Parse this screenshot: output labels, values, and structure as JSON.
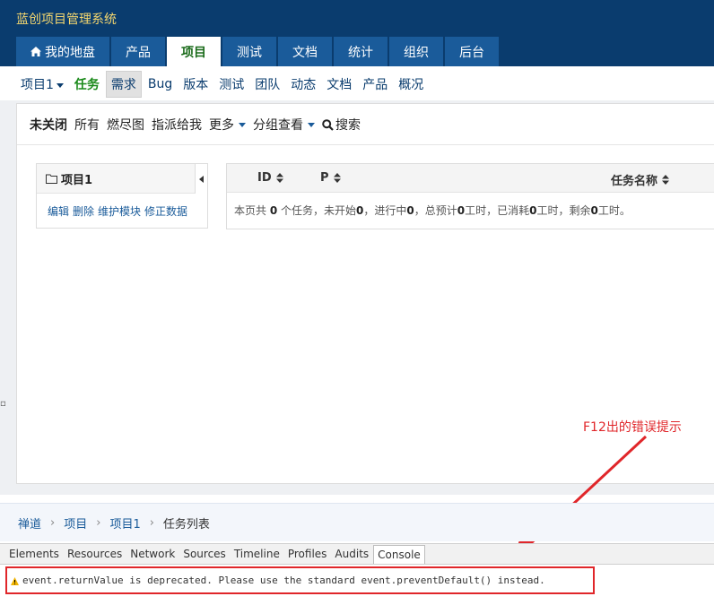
{
  "app_title": "蓝创项目管理系统",
  "main_tabs": [
    "我的地盘",
    "产品",
    "项目",
    "测试",
    "文档",
    "统计",
    "组织",
    "后台"
  ],
  "subnav": {
    "project_selector": "项目1",
    "items": [
      "任务",
      "需求",
      "Bug",
      "版本",
      "测试",
      "团队",
      "动态",
      "文档",
      "产品",
      "概况"
    ]
  },
  "filters": {
    "unclosed": "未关闭",
    "all": "所有",
    "burndown": "燃尽图",
    "assigned_to_me": "指派给我",
    "more": "更多",
    "group_view": "分组查看",
    "search": "搜索"
  },
  "tree": {
    "title": "项目1",
    "actions": [
      "编辑",
      "删除",
      "维护模块",
      "修正数据"
    ]
  },
  "table": {
    "columns": [
      "ID",
      "P",
      "任务名称"
    ],
    "summary": {
      "p1": "本页共",
      "n1": "0",
      "p2": "个任务，未开始",
      "n2": "0",
      "p3": "，进行中",
      "n3": "0",
      "p4": "，总预计",
      "n4": "0",
      "p5": "工时，已消耗",
      "n5": "0",
      "p6": "工时，剩余",
      "n6": "0",
      "p7": "工时。"
    }
  },
  "breadcrumb": [
    "禅道",
    "项目",
    "项目1",
    "任务列表"
  ],
  "devtools": {
    "tabs": [
      "Elements",
      "Resources",
      "Network",
      "Sources",
      "Timeline",
      "Profiles",
      "Audits",
      "Console"
    ],
    "active_tab": "Console",
    "message": "event.returnValue is deprecated. Please use the standard event.preventDefault() instead."
  },
  "annotation": "F12出的错误提示",
  "colors": {
    "header": "#0a3c6e",
    "tab": "#1a5b9a",
    "active_text": "#1a6b1a",
    "annotation": "#e0262a",
    "title": "#f5d76e"
  }
}
